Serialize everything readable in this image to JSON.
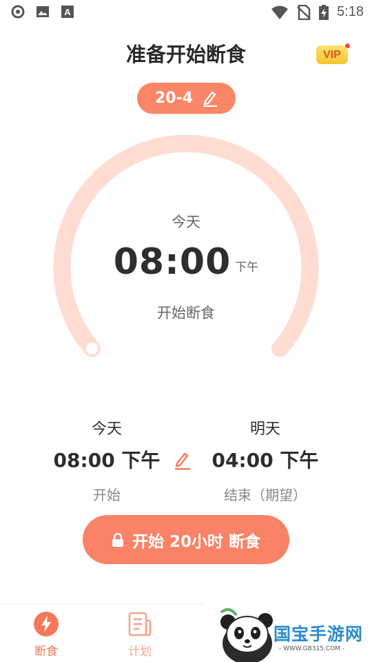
{
  "status_bar": {
    "time": "5:18",
    "icons": [
      "circle-g-icon",
      "image-icon",
      "a-box-icon",
      "wifi-icon",
      "no-sim-icon",
      "battery-charging-icon"
    ]
  },
  "header": {
    "title": "准备开始断食",
    "vip_label": "VIP"
  },
  "plan": {
    "label": "20-4",
    "edit_icon": "pencil-icon"
  },
  "ring": {
    "day": "今天",
    "time": "08:00",
    "ampm": "下午",
    "caption": "开始断食",
    "progress": 0,
    "colors": {
      "track": "#ffdcd2",
      "knob": "#ffffff"
    }
  },
  "times": {
    "start": {
      "day": "今天",
      "time": "08:00 下午",
      "label": "开始"
    },
    "end": {
      "day": "明天",
      "time": "04:00 下午",
      "label": "结束（期望）"
    }
  },
  "start_button": {
    "label": "开始 20小时 断食",
    "icon": "lock-icon"
  },
  "bottom_nav": {
    "items": [
      {
        "label": "断食",
        "icon": "lightning-icon",
        "active": true
      },
      {
        "label": "计划",
        "icon": "plan-list-icon",
        "active": false
      }
    ]
  },
  "watermark": {
    "text": "国宝手游网",
    "url": "- WWW.GB315.COM -"
  },
  "colors": {
    "accent": "#fa8266",
    "accent_light": "#ffdcd2",
    "text_dark": "#2d2d2d",
    "text_muted": "#888888"
  }
}
